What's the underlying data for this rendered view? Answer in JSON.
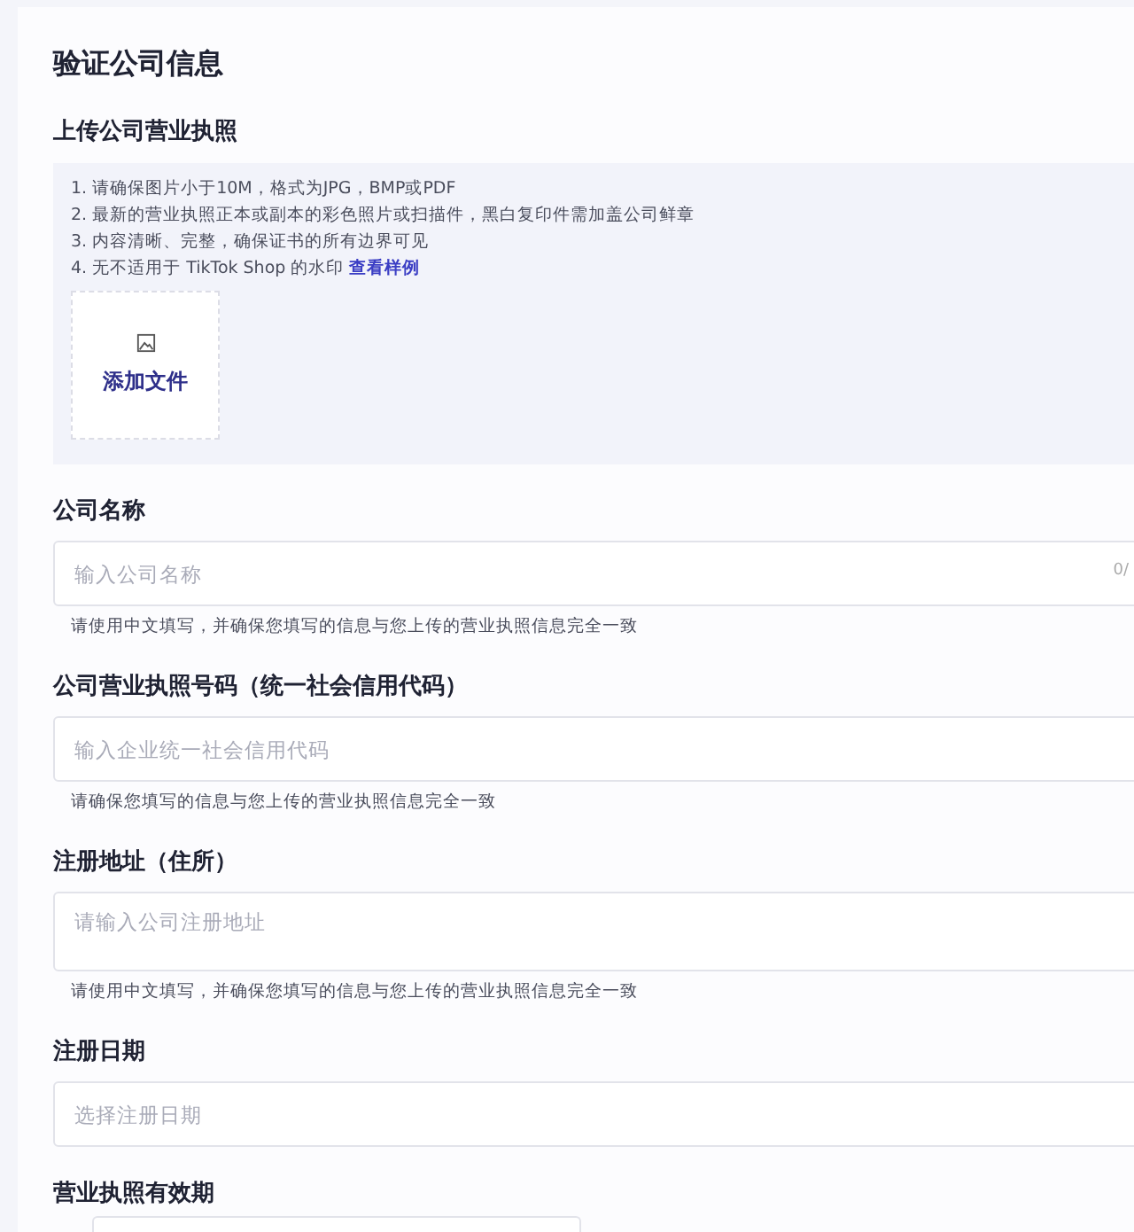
{
  "title": "验证公司信息",
  "upload": {
    "label": "上传公司营业执照",
    "requirements": [
      "1. 请确保图片小于10M，格式为JPG，BMP或PDF",
      "2. 最新的营业执照正本或副本的彩色照片或扫描件，黑白复印件需加盖公司鲜章",
      "3. 内容清晰、完整，确保证书的所有边界可见",
      "4. 无不适用于 TikTok Shop 的水印"
    ],
    "example_link": "查看样例",
    "button": "添加文件"
  },
  "fields": [
    {
      "kind": "input",
      "label": "公司名称",
      "placeholder": "输入公司名称",
      "counter": "0/",
      "hint": "请使用中文填写，并确保您填写的信息与您上传的营业执照信息完全一致"
    },
    {
      "kind": "input",
      "label": "公司营业执照号码（统一社会信用代码）",
      "placeholder": "输入企业统一社会信用代码",
      "hint": "请确保您填写的信息与您上传的营业执照信息完全一致"
    },
    {
      "kind": "textarea",
      "label": "注册地址（住所）",
      "placeholder": "请输入公司注册地址",
      "hint": "请使用中文填写，并确保您填写的信息与您上传的营业执照信息完全一致"
    },
    {
      "kind": "input",
      "label": "注册日期",
      "placeholder": "选择注册日期"
    },
    {
      "kind": "range",
      "label": "营业执照有效期"
    }
  ]
}
